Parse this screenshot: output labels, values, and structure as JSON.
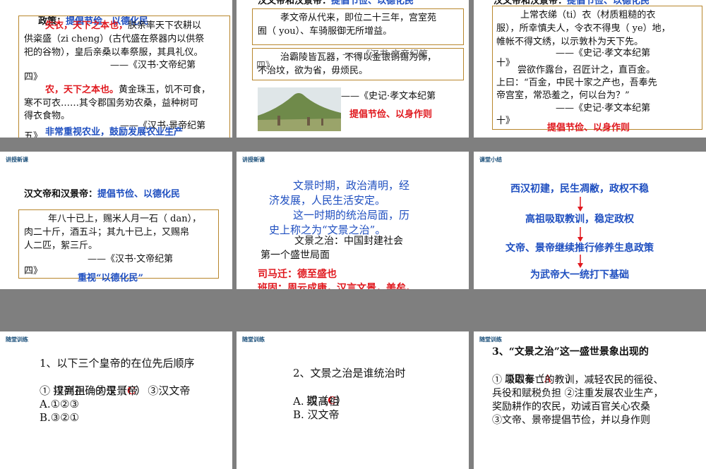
{
  "s1": {
    "policy_label": "政策：",
    "policy_value": "提倡节俭、以德化民",
    "l1_red": "失衣，天下之本也，",
    "l1_rest": "朕亲率天下农耕以",
    "l2": "供粢盛（zi cheng）(古代盛在祭器内以供祭",
    "l3": "祀的谷物），皇后亲桑以奉祭服，其具礼仪。",
    "src1": "——《汉书·文帝纪第",
    "src1b": "四》",
    "l5_red": "农，天下之本也。",
    "l5_rest": "黄金珠玉，饥不可食，",
    "l6": "寒不可衣……其令郡国务劝农桑，益种树可",
    "l7": "得衣食物。",
    "src2": "——《汉书·景帝纪第",
    "src2b": "五》",
    "note": "非常重视农业，鼓励发展农业生产"
  },
  "s2": {
    "title_a": "汉文帝和汉景帝：",
    "title_b": "提倡节俭、以德化民",
    "p1a": "孝文帝从代来，即位二十三年，宫室苑",
    "p1b": "囿（ you）、车骑服御无所增益。",
    "p2a": "治霸陵皆瓦器，不得以金银铜锡为饰，",
    "p2b": "不治坟，欲为省，毋烦民。",
    "src_mid": "——《汉书·文帝纪第",
    "src_mid2": "四》",
    "src": "——《史记·孝文本纪第",
    "note": "提倡节俭、以身作则"
  },
  "s3": {
    "title_a": "汉文帝和汉景帝：",
    "title_b": "提倡节俭、以德化民",
    "p1a": "上常衣绨（ti）衣（材质粗糙的衣",
    "p1b": "服），所幸慎夫人，令衣不得曳（ ye）地，",
    "p1c": "帷帐不得文绣，以示敦朴为天下先。",
    "src1": "——《史记·孝文本纪第",
    "src1b": "十》",
    "p2a": "尝欲作露台，召匠计之，直百金。",
    "p2b": "上曰：“百金，中民十家之产也，吾奉先",
    "p2c": "帝宫室，常恐羞之，何以台为？”",
    "src2": "——《史记·孝文本纪第",
    "src2b": "十》",
    "note": "提倡节俭、以身作则"
  },
  "s4": {
    "header": "讲授新课",
    "title_a": "汉文帝和汉景帝：",
    "title_b": "提倡节俭、以德化民",
    "p1": "年八十已上，赐米人月一石（ dan），",
    "p2": "肉二十斤，酒五斗；其九十已上，又赐帛",
    "p3": "人二匹，絮三斤。",
    "src": "——《汉书·文帝纪第",
    "src2": "四》",
    "note": "重视“以德化民”"
  },
  "s5": {
    "header": "讲授新课",
    "b1": "文景时期，政治清明，经",
    "b2": "济发展，人民生活安定。",
    "b3": "这一时期的统治局面，历",
    "b4": "史上称之为“文景之治”。",
    "k1": "文景之治：中国封建社会",
    "k2": "第一个盛世局面",
    "r1": "司马迁：德至盛也",
    "r2": "班固：周云成康，汉言文景，美矣。"
  },
  "s6": {
    "header": "课堂小结",
    "f1": "西汉初建，民生凋敝，政权不稳",
    "f2": "高祖吸取教训，稳定政权",
    "f3": "文帝、景帝继续推行修养生息政策",
    "f4": "为武帝大一统打下基础"
  },
  "s7": {
    "header": "随堂训练",
    "q1": "1、以下三个皇帝的在位先后顺序",
    "q2": "排列正确的是（",
    "ans": "C",
    "q2end": "）",
    "opts": "① 汉高祖   ②汉景帝   ③汉文帝",
    "a": "A.①②③",
    "b": "B.③②①"
  },
  "s8": {
    "header": "随堂训练",
    "q1": "2、文景之治是谁统治时",
    "q2": "期（",
    "ans": "C",
    "q2end": "）",
    "a": "A. 汉高祖",
    "b": "B. 汉文帝"
  },
  "s9": {
    "header": "随堂训练",
    "q1": "3、“文景之治”这一盛世景象出现的",
    "q2": "原因有（",
    "ans": "A",
    "q2end": "）",
    "c1": "① 吸取秦亡的教训，减轻农民的徭役、",
    "c2": "兵役和赋税负担 ②注重发展农业生产，",
    "c3": "奖励耕作的农民，劝诫百官关心农桑",
    "c4": "③文帝、景帝提倡节俭，并以身作则"
  }
}
